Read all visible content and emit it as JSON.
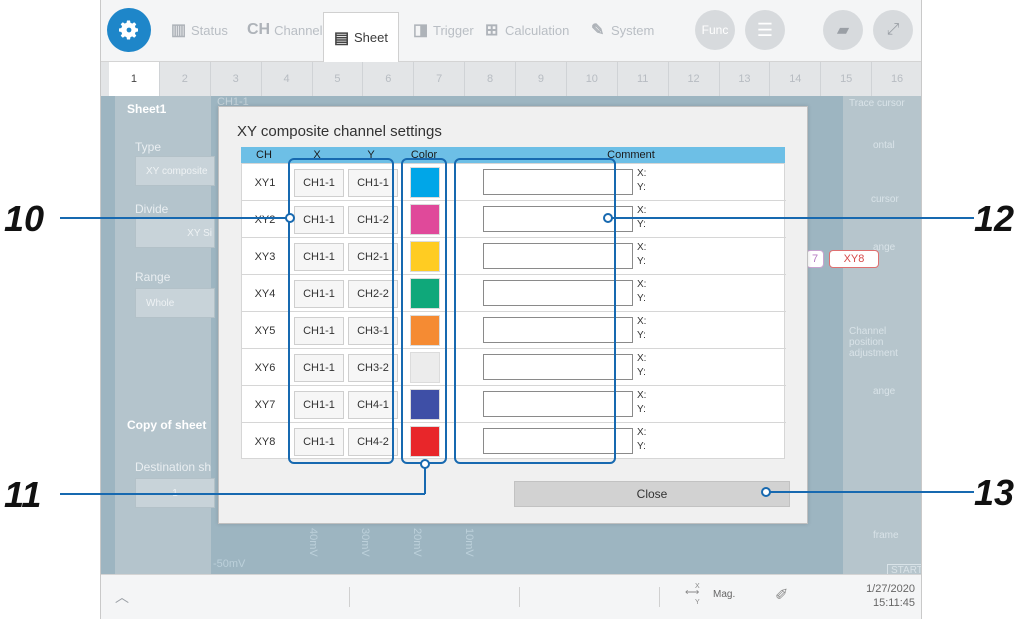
{
  "toolbar": {
    "tabs": [
      {
        "label": "Status",
        "icon": "waveform-icon"
      },
      {
        "label": "Channel",
        "icon_text": "CH"
      },
      {
        "label": "Sheet",
        "icon": "sheet-icon"
      },
      {
        "label": "Trigger",
        "icon": "trigger-icon"
      },
      {
        "label": "Calculation",
        "icon": "calculation-icon"
      },
      {
        "label": "System",
        "icon": "wrench-icon"
      }
    ],
    "func_label": "Func"
  },
  "sheet_tabs": [
    "1",
    "2",
    "3",
    "4",
    "5",
    "6",
    "7",
    "8",
    "9",
    "10",
    "11",
    "12",
    "13",
    "14",
    "15",
    "16"
  ],
  "left_panel": {
    "sheet_title": "Sheet1",
    "type_label": "Type",
    "type_value": "XY composite",
    "divide_label": "Divide",
    "divide_value": "XY Si",
    "range_label": "Range",
    "range_value": "Whole",
    "copy_title": "Copy of sheet",
    "destination_label": "Destination sh",
    "destination_value": "1"
  },
  "right_panel": {
    "items": [
      "Trace cursor",
      "ontal",
      "cursor",
      "ange",
      "Channel position adjustment",
      "ange",
      "frame"
    ],
    "start_label": "START"
  },
  "badges": {
    "xy7": "7",
    "xy8": "XY8"
  },
  "background_labels": {
    "ch_label": "CH1-1",
    "scale_bottom": "-50mV",
    "scale_values": [
      "40mV",
      "30mV",
      "20mV",
      "10mV"
    ]
  },
  "dialog": {
    "title": "XY composite channel settings",
    "headers": {
      "ch": "CH",
      "x": "X",
      "y": "Y",
      "color": "Color",
      "comment": "Comment"
    },
    "rows": [
      {
        "ch": "XY1",
        "x": "CH1-1",
        "y": "CH1-1",
        "color": "#00a6e8",
        "xlab": "X:",
        "ylab": "Y:"
      },
      {
        "ch": "XY2",
        "x": "CH1-1",
        "y": "CH1-2",
        "color": "#e0499a",
        "xlab": "X:",
        "ylab": "Y:"
      },
      {
        "ch": "XY3",
        "x": "CH1-1",
        "y": "CH2-1",
        "color": "#ffcc22",
        "xlab": "X:",
        "ylab": "Y:"
      },
      {
        "ch": "XY4",
        "x": "CH1-1",
        "y": "CH2-2",
        "color": "#0fa87a",
        "xlab": "X:",
        "ylab": "Y:"
      },
      {
        "ch": "XY5",
        "x": "CH1-1",
        "y": "CH3-1",
        "color": "#f58b33",
        "xlab": "X:",
        "ylab": "Y:"
      },
      {
        "ch": "XY6",
        "x": "CH1-1",
        "y": "CH3-2",
        "color": "#ececec",
        "xlab": "X:",
        "ylab": "Y:"
      },
      {
        "ch": "XY7",
        "x": "CH1-1",
        "y": "CH4-1",
        "color": "#3e4fa6",
        "xlab": "X:",
        "ylab": "Y:"
      },
      {
        "ch": "XY8",
        "x": "CH1-1",
        "y": "CH4-2",
        "color": "#e8262a",
        "xlab": "X:",
        "ylab": "Y:"
      }
    ],
    "close_label": "Close"
  },
  "bottom_bar": {
    "mag_label": "Mag.",
    "mag_x": "X",
    "mag_y": "Y",
    "date": "1/27/2020",
    "time": "15:11:45"
  },
  "callouts": {
    "c10": "10",
    "c11": "11",
    "c12": "12",
    "c13": "13"
  },
  "colors": {
    "accent": "#1e86c9",
    "highlight": "#1769b0",
    "header": "#6dbfe6"
  }
}
